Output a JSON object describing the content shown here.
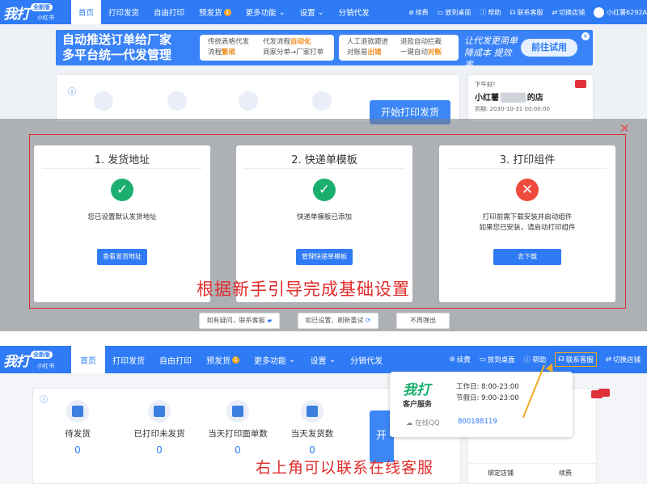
{
  "app": {
    "logo": "我打",
    "version_badge": "全新版",
    "logo_sub": "小红书"
  },
  "nav": [
    "首页",
    "打印发货",
    "自由打印",
    "预发货",
    "更多功能",
    "设置",
    "分销代发"
  ],
  "nav_badge": "1",
  "rnav": {
    "renew": "续费",
    "desktop": "放到桌面",
    "help": "帮助",
    "service": "联系客服",
    "switch": "切换店铺",
    "user": "小红薯6292A"
  },
  "banner": {
    "title1": "自动推送订单给厂家",
    "title2": "多平台统一代发管理",
    "card1_l1": "传统表格代发",
    "card1_l2": "流程",
    "card1_hl": "繁琐",
    "card2_l1": "代发流程",
    "card2_hl1": "自动化",
    "card2_l2": "商家分单→厂家打单",
    "card3_l1": "人工退款跟进",
    "card3_l2": "对账易",
    "card3_hl": "出错",
    "card4_l1": "退款自动拦截",
    "card4_l2": "一键自动",
    "card4_hl": "对账",
    "ad": "让代发更简单 降成本 提效率",
    "go": "前往试用"
  },
  "shop": {
    "greet": "下午好!",
    "name": "小红薯",
    "name_tail": "的店",
    "expire": "到期: 2030-10-31 00:00:00"
  },
  "start_print": "开始打印发货",
  "steps": [
    {
      "title": "1. 发货地址",
      "desc": "您已设置默认发货地址",
      "desc2": "",
      "button": "查看发货地址"
    },
    {
      "title": "2. 快递单模板",
      "desc": "快递单模板已添加",
      "desc2": "",
      "button": "管理快递单模板"
    },
    {
      "title": "3. 打印组件",
      "desc": "打印前需下载安装并启动组件",
      "desc2": "如果您已安装，请启动打印组件",
      "button": "去下载"
    }
  ],
  "guide_text": "根据新手引导完成基础设置",
  "bottom_buttons": [
    "如有疑问，联系客服",
    "如已设置，刷新重试",
    "不再弹出"
  ],
  "stats": [
    {
      "label": "待发货",
      "value": "0"
    },
    {
      "label": "已打印未发货",
      "value": "0"
    },
    {
      "label": "当天打印面单数",
      "value": "0"
    },
    {
      "label": "当天发货数",
      "value": "0"
    }
  ],
  "popup": {
    "logo": "我打",
    "title": "客户服务",
    "work": "工作日: 8:00-23:00",
    "holiday": "节假日: 9:00-23:00",
    "online": "在线QQ",
    "qq": "800188119"
  },
  "bottom_caption": "右上角可以联系在线客服",
  "bottom_links": [
    "绑定店铺",
    "续费"
  ],
  "colors": {
    "primary": "#2f7bf5",
    "success": "#1aae6f",
    "error": "#ef4b3c",
    "highlight": "#f2a923",
    "annot": "#e12b2b"
  }
}
